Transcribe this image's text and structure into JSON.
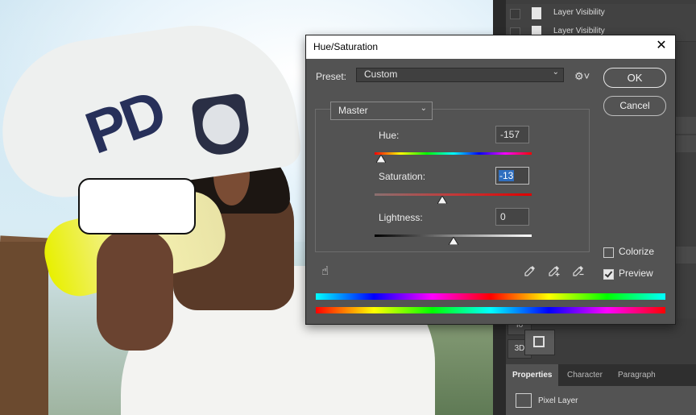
{
  "layers": {
    "rows": [
      {
        "label": "Layer Visibility"
      },
      {
        "label": "Layer Visibility"
      }
    ],
    "side_buttons": {
      "io": "Io",
      "three_d": "3D"
    }
  },
  "bottom_panel": {
    "tabs": [
      {
        "label": "Properties",
        "active": true
      },
      {
        "label": "Character",
        "active": false
      },
      {
        "label": "Paragraph",
        "active": false
      }
    ],
    "property_label": "Pixel Layer"
  },
  "dialog": {
    "title": "Hue/Saturation",
    "close_icon": "✕",
    "preset_label": "Preset:",
    "preset_value": "Custom",
    "ok_label": "OK",
    "cancel_label": "Cancel",
    "channel_value": "Master",
    "sliders": {
      "hue": {
        "label": "Hue:",
        "value": "-157",
        "position": 0.04
      },
      "saturation": {
        "label": "Saturation:",
        "value": "-13",
        "position": 0.43
      },
      "lightness": {
        "label": "Lightness:",
        "value": "0",
        "position": 0.5
      }
    },
    "colorize_label": "Colorize",
    "colorize_checked": false,
    "preview_label": "Preview",
    "preview_checked": true
  },
  "icons": {
    "gear": "gear-icon",
    "hand": "hand-target-icon",
    "droppers": [
      "eyedropper-icon",
      "eyedropper-plus-icon",
      "eyedropper-minus-icon"
    ]
  }
}
